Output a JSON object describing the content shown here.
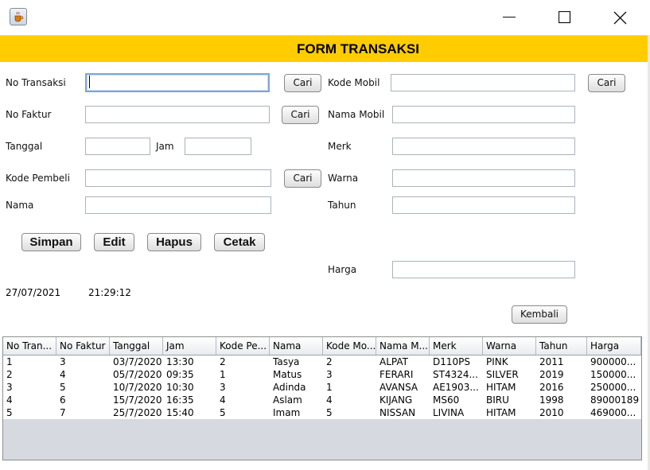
{
  "header": {
    "title": "FORM TRANSAKSI"
  },
  "labels": {
    "no_transaksi": "No Transaksi",
    "no_faktur": "No Faktur",
    "tanggal": "Tanggal",
    "jam": "Jam",
    "kode_pembeli": "Kode Pembeli",
    "nama": "Nama",
    "kode_mobil": "Kode Mobil",
    "nama_mobil": "Nama Mobil",
    "merk": "Merk",
    "warna": "Warna",
    "tahun": "Tahun",
    "harga": "Harga"
  },
  "fields": {
    "no_transaksi": "",
    "no_faktur": "",
    "tanggal": "",
    "jam": "",
    "kode_pembeli": "",
    "nama": "",
    "kode_mobil": "",
    "nama_mobil": "",
    "merk": "",
    "warna": "",
    "tahun": "",
    "harga": ""
  },
  "buttons": {
    "cari": "Cari",
    "simpan": "Simpan",
    "edit": "Edit",
    "hapus": "Hapus",
    "cetak": "Cetak",
    "kembali": "Kembali"
  },
  "status": {
    "date": "27/07/2021",
    "time": "21:29:12"
  },
  "table": {
    "columns": [
      "No Tran...",
      "No Faktur",
      "Tanggal",
      "Jam",
      "Kode Pe...",
      "Nama",
      "Kode Mo...",
      "Nama M...",
      "Merk",
      "Warna",
      "Tahun",
      "Harga"
    ],
    "rows": [
      [
        "1",
        "3",
        "03/7/2020",
        "13:30",
        "2",
        "Tasya",
        "2",
        "ALPAT",
        "D110PS",
        "PINK",
        "2011",
        "900000..."
      ],
      [
        "2",
        "4",
        "05/7/2020",
        "09:35",
        "1",
        "Matus",
        "3",
        "FERARI",
        "ST4324...",
        "SILVER",
        "2019",
        "150000..."
      ],
      [
        "3",
        "5",
        "10/7/2020",
        "10:30",
        "3",
        "Adinda",
        "1",
        "AVANSA",
        "AE1903...",
        "HITAM",
        "2016",
        "250000..."
      ],
      [
        "4",
        "6",
        "15/7/2020",
        "16:35",
        "4",
        "Aslam",
        "4",
        "KIJANG",
        "MS60",
        "BIRU",
        "1998",
        "89000189"
      ],
      [
        "5",
        "7",
        "25/7/2020",
        "15:40",
        "5",
        "Imam",
        "5",
        "NISSAN",
        "LIVINA",
        "HITAM",
        "2010",
        "469000..."
      ]
    ]
  },
  "colors": {
    "header_bg": "#ffcc00",
    "table_bg": "#d6d9df"
  },
  "icons": {
    "app": "java-cup-icon",
    "minimize": "minimize-icon",
    "maximize": "maximize-icon",
    "close": "close-icon"
  }
}
